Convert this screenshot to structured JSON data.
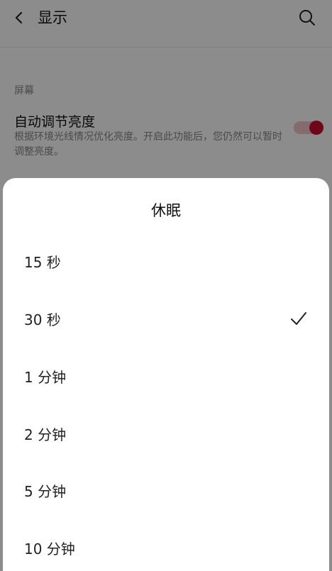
{
  "header": {
    "title": "显示",
    "back_icon": "chevron-left-icon",
    "search_icon": "search-icon"
  },
  "screen_section": {
    "label": "屏幕",
    "auto_brightness": {
      "title": "自动调节亮度",
      "description": "根据环境光线情况优化亮度。开启此功能后，您仍然可以暂时调整亮度。",
      "enabled": true
    }
  },
  "sleep_sheet": {
    "title": "休眠",
    "options": [
      {
        "label": "15 秒",
        "selected": false
      },
      {
        "label": "30 秒",
        "selected": true
      },
      {
        "label": "1 分钟",
        "selected": false
      },
      {
        "label": "2 分钟",
        "selected": false
      },
      {
        "label": "5 分钟",
        "selected": false
      },
      {
        "label": "10 分钟",
        "selected": false
      }
    ],
    "check_icon": "checkmark-icon"
  },
  "colors": {
    "accent": "#c8102e",
    "toggle_track": "#f0c3c8"
  }
}
